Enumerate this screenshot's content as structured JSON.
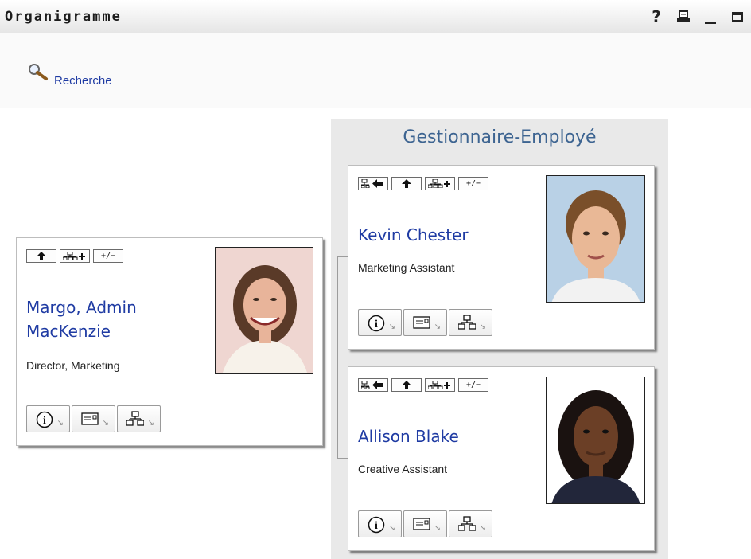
{
  "window": {
    "title": "Organigramme"
  },
  "search": {
    "label": "Recherche"
  },
  "panel": {
    "title": "Gestionnaire-Employé"
  },
  "actions": {
    "plus_minus": "+/−"
  },
  "cards": [
    {
      "name_line1": "Margo, Admin",
      "name_line2": "MacKenzie",
      "role": "Director, Marketing"
    },
    {
      "name": "Kevin Chester",
      "role": "Marketing Assistant"
    },
    {
      "name": "Allison Blake",
      "role": "Creative Assistant"
    }
  ]
}
